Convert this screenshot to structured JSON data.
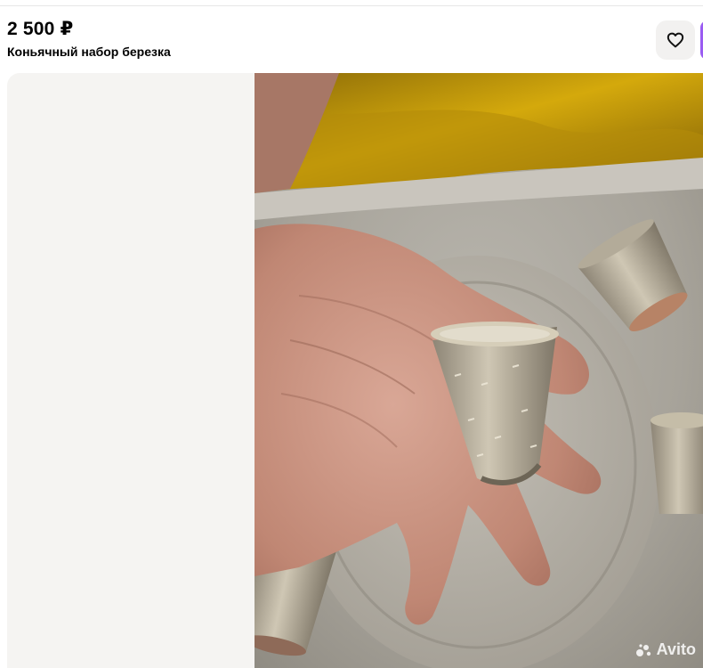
{
  "listing": {
    "price": "2 500 ₽",
    "title": "Коньячный набор березка"
  },
  "actions": {
    "favorite_icon": "heart-icon"
  },
  "gallery": {
    "watermark": "Avito"
  },
  "colors": {
    "favorite_bg": "#f2f1f0",
    "accent_purple": "#9a5cf2",
    "gallery_bg": "#f5f4f2"
  }
}
